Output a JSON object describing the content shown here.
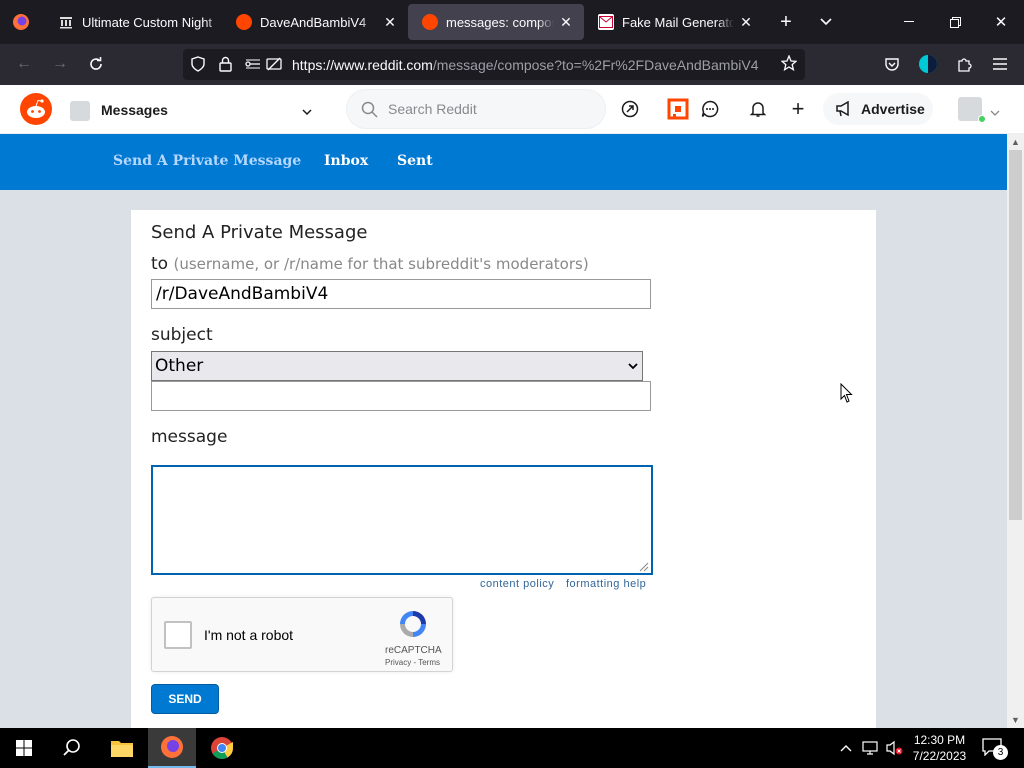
{
  "browser": {
    "tabs": [
      {
        "title": "Ultimate Custom Night",
        "active": false
      },
      {
        "title": "DaveAndBambiV4",
        "active": false
      },
      {
        "title": "messages: compose",
        "active": true
      },
      {
        "title": "Fake Mail Generator - F",
        "active": false
      }
    ],
    "url_domain": "https://www.reddit.com",
    "url_path": "/message/compose?to=%2Fr%2FDaveAndBambiV4"
  },
  "reddit_header": {
    "community_label": "Messages",
    "search_placeholder": "Search Reddit",
    "advertise_label": "Advertise"
  },
  "message_nav": {
    "send_label": "Send A Private Message",
    "inbox_label": "Inbox",
    "sent_label": "Sent"
  },
  "form": {
    "heading": "Send A Private Message",
    "to_label": "to",
    "to_hint": "(username, or /r/name for that subreddit's moderators)",
    "to_value": "/r/DaveAndBambiV4",
    "subject_label": "subject",
    "subject_selected": "Other",
    "subject_text": "",
    "message_label": "message",
    "message_text": "",
    "content_policy": "content policy",
    "formatting_help": "formatting help",
    "send_label": "SEND"
  },
  "captcha": {
    "label": "I'm not a robot",
    "brand": "reCAPTCHA",
    "privacy": "Privacy",
    "terms": "Terms",
    "separator": " - "
  },
  "taskbar": {
    "time": "12:30 PM",
    "date": "7/22/2023",
    "notification_count": "3"
  },
  "colors": {
    "reddit_orange": "#ff4500",
    "reddit_blue": "#0079d3",
    "browser_dark": "#1c1b22"
  }
}
